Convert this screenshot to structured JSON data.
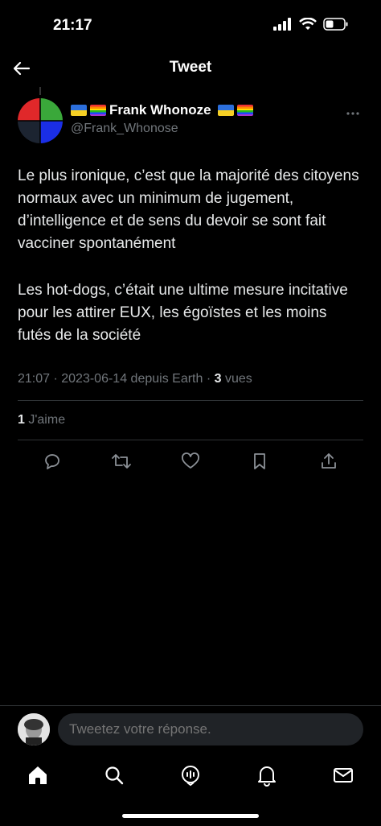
{
  "status_bar": {
    "time": "21:17"
  },
  "nav": {
    "title": "Tweet"
  },
  "tweet": {
    "author_name": "Frank Whonoze",
    "author_handle": "@Frank_Whonose",
    "paragraph1": "Le plus ironique, c’est que la majorité des citoyens normaux avec un minimum de jugement, d’intelligence et de sens du devoir se sont fait vacciner spontanément",
    "paragraph2": "Les hot-dogs, c’était une ultime mesure incitative pour les attirer EUX, les égoïstes et les moins futés de la société",
    "meta_text": "21:07 · 2023-06-14 depuis Earth · ",
    "views_count": "3",
    "views_label": " vues",
    "likes_count": "1",
    "likes_label": " J'aime"
  },
  "reply": {
    "placeholder": "Tweetez votre réponse."
  },
  "icons": {
    "back": "arrow-left-icon",
    "more": "more-dots-icon",
    "actions": [
      "reply-icon",
      "retweet-icon",
      "like-icon",
      "bookmark-icon",
      "share-icon"
    ],
    "tabs": [
      "home-icon",
      "search-icon",
      "spaces-icon",
      "notifications-icon",
      "messages-icon"
    ]
  },
  "colors": {
    "background": "#000000",
    "text": "#e7e9ea",
    "muted": "#71767b",
    "divider": "#2f3336"
  }
}
